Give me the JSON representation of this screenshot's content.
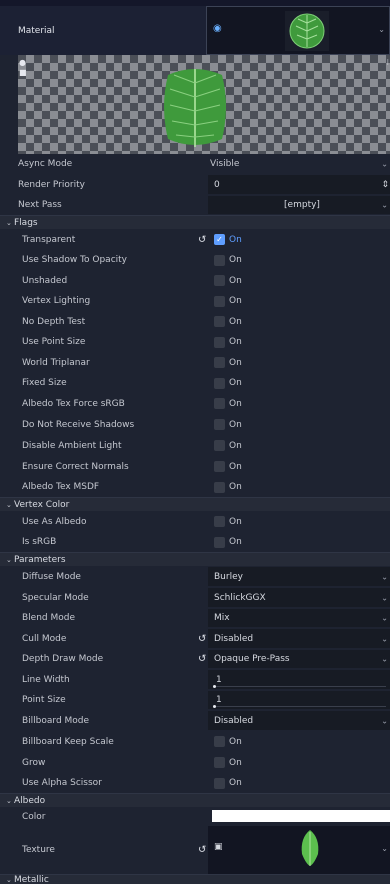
{
  "header": {
    "title": "Material",
    "resource_icon": "sphere-icon",
    "chevron": "⌄"
  },
  "preview": {
    "icons": [
      "light-icon",
      "sphere-toggle-icon"
    ]
  },
  "props_top": [
    {
      "label": "Async Mode",
      "value": "Visible"
    },
    {
      "label": "Render Priority",
      "value": "0"
    },
    {
      "label": "Next Pass",
      "value": "[empty]"
    }
  ],
  "flags": {
    "title": "Flags",
    "items": [
      {
        "label": "Transparent",
        "value": "On",
        "checked": true,
        "revert": true
      },
      {
        "label": "Use Shadow To Opacity",
        "value": "On"
      },
      {
        "label": "Unshaded",
        "value": "On"
      },
      {
        "label": "Vertex Lighting",
        "value": "On"
      },
      {
        "label": "No Depth Test",
        "value": "On"
      },
      {
        "label": "Use Point Size",
        "value": "On"
      },
      {
        "label": "World Triplanar",
        "value": "On"
      },
      {
        "label": "Fixed Size",
        "value": "On"
      },
      {
        "label": "Albedo Tex Force sRGB",
        "value": "On"
      },
      {
        "label": "Do Not Receive Shadows",
        "value": "On"
      },
      {
        "label": "Disable Ambient Light",
        "value": "On"
      },
      {
        "label": "Ensure Correct Normals",
        "value": "On"
      },
      {
        "label": "Albedo Tex MSDF",
        "value": "On"
      }
    ]
  },
  "vertex_color": {
    "title": "Vertex Color",
    "items": [
      {
        "label": "Use As Albedo",
        "value": "On"
      },
      {
        "label": "Is sRGB",
        "value": "On"
      }
    ]
  },
  "parameters": {
    "title": "Parameters",
    "diffuse_mode": {
      "label": "Diffuse Mode",
      "value": "Burley"
    },
    "specular_mode": {
      "label": "Specular Mode",
      "value": "SchlickGGX"
    },
    "blend_mode": {
      "label": "Blend Mode",
      "value": "Mix"
    },
    "cull_mode": {
      "label": "Cull Mode",
      "value": "Disabled"
    },
    "depth_draw_mode": {
      "label": "Depth Draw Mode",
      "value": "Opaque Pre-Pass"
    },
    "line_width": {
      "label": "Line Width",
      "value": "1"
    },
    "point_size": {
      "label": "Point Size",
      "value": "1"
    },
    "billboard_mode": {
      "label": "Billboard Mode",
      "value": "Disabled"
    },
    "billboard_keep_scale": {
      "label": "Billboard Keep Scale",
      "value": "On"
    },
    "grow": {
      "label": "Grow",
      "value": "On"
    },
    "use_alpha_scissor": {
      "label": "Use Alpha Scissor",
      "value": "On"
    }
  },
  "albedo": {
    "title": "Albedo",
    "color": {
      "label": "Color",
      "value": "#ffffff"
    },
    "texture": {
      "label": "Texture"
    }
  },
  "metallic": {
    "title": "Metallic"
  },
  "colors": {
    "accent": "#5f9eff",
    "background": "#1e2331",
    "leaf": "#3f9a3c"
  }
}
